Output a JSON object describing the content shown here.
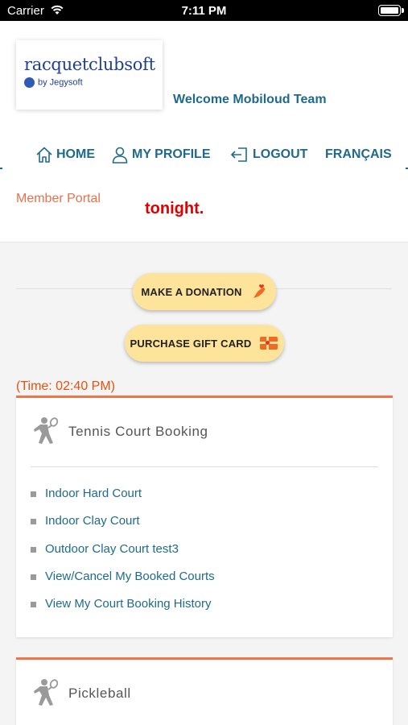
{
  "status_bar": {
    "carrier": "Carrier",
    "time": "7:11 PM",
    "battery_level": 1.0
  },
  "header": {
    "logo_wordmark": "racquetclubsoft",
    "logo_byline": "by Jegysoft",
    "welcome": "Welcome Mobiloud Team"
  },
  "nav": {
    "home": "HOME",
    "profile": "MY PROFILE",
    "logout": "LOGOUT",
    "language": "FRANÇAIS"
  },
  "banner": {
    "member_portal": "Member Portal",
    "ticker": "tonight."
  },
  "actions": {
    "donate": "MAKE A DONATION",
    "gift_card": "PURCHASE GIFT CARD"
  },
  "time_label": "(Time: 02:40 PM)",
  "tennis": {
    "title": "Tennis Court Booking",
    "links": [
      "Indoor Hard Court",
      "Indoor Clay Court",
      "Outdoor Clay Court test3",
      "View/Cancel My Booked Courts",
      "View My Court Booking History"
    ]
  },
  "pickleball": {
    "title": "Pickleball"
  },
  "colors": {
    "accent_blue": "#1f6a8c",
    "accent_orange": "#ef7447",
    "pill_yellow": "#fde49a",
    "ticker_red": "#e00000"
  },
  "icons": {
    "wifi": "wifi-icon",
    "home": "home-icon",
    "profile": "user-icon",
    "logout": "logout-icon",
    "donate": "hand-heart-icon",
    "gift": "gift-icon",
    "sport": "tennis-player-icon"
  }
}
